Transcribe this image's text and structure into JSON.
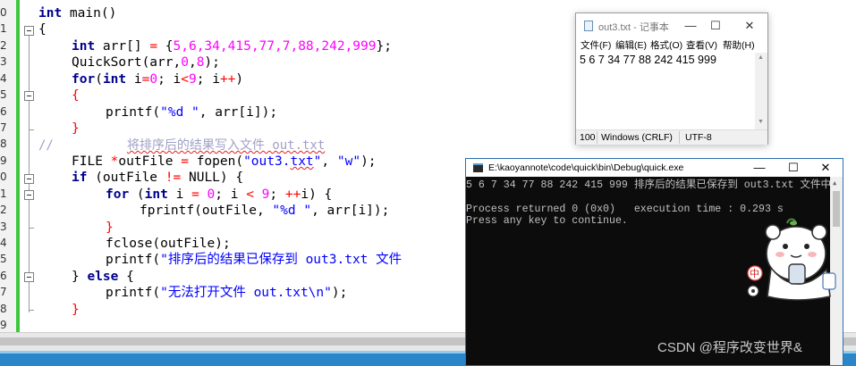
{
  "editor": {
    "line_numbers": [
      "0",
      "1",
      "2",
      "3",
      "4",
      "5",
      "6",
      "7",
      "8",
      "9",
      "0",
      "1",
      "2",
      "3",
      "4",
      "5",
      "6",
      "7",
      "8",
      "9"
    ],
    "code": {
      "l1": {
        "kw": "int",
        "rest": " main()"
      },
      "l2": {
        "brace": "{"
      },
      "l3": {
        "kw": "int",
        "a": " arr[] ",
        "op": "=",
        "b": " {",
        "nums": "5,6,34,415,77,7,88,242,999",
        "c": "};"
      },
      "l4": {
        "a": "QuickSort(arr,",
        "n1": "0",
        "b": ",",
        "n2": "8",
        "c": ");"
      },
      "l5": {
        "kw": "for",
        "a": "(",
        "kw2": "int",
        "b": " i",
        "op": "=",
        "n1": "0",
        "c": "; i",
        "op2": "<",
        "n2": "9",
        "d": "; i",
        "op3": "++",
        "e": ")"
      },
      "l6": {
        "brace": "{"
      },
      "l7": {
        "a": "printf(",
        "str": "\"%d \"",
        "b": ", arr[i]);"
      },
      "l8": {
        "brace": "}"
      },
      "l9": {
        "comment_marker": "//",
        "comment_text": "将排序后的结果写入文件 out.txt"
      },
      "l10": {
        "a": "FILE ",
        "op": "*",
        "b": "outFile ",
        "op2": "=",
        "c": " fopen(",
        "str1a": "\"out3.",
        "str1b": "txt",
        "str1c": "\"",
        "d": ", ",
        "str2": "\"w\"",
        "e": ");"
      },
      "l11": {
        "kw": "if",
        "a": " (outFile ",
        "op": "!=",
        "b": " NULL) {"
      },
      "l12": {
        "kw": "for",
        "a": " (",
        "kw2": "int",
        "b": " i ",
        "op": "=",
        "sp": " ",
        "n1": "0",
        "c": "; i ",
        "op2": "<",
        "sp2": " ",
        "n2": "9",
        "d": "; ",
        "op3": "++",
        "e": "i) {"
      },
      "l13": {
        "a": "fprintf(outFile, ",
        "str": "\"%d \"",
        "b": ", arr[i]);"
      },
      "l14": {
        "brace": "}"
      },
      "l15": {
        "a": "fclose(outFile);"
      },
      "l16": {
        "a": "printf(",
        "str": "\"排序后的结果已保存到 out3.txt 文件"
      },
      "l17": {
        "a": "} ",
        "kw": "else",
        "b": " {"
      },
      "l18": {
        "a": "printf(",
        "str": "\"无法打开文件 out.txt\\n\"",
        "b": ");"
      },
      "l19": {
        "brace": "}"
      }
    }
  },
  "notepad": {
    "title": "out3.txt - 记事本",
    "controls": {
      "minimize": "—",
      "maximize": "☐",
      "close": "✕"
    },
    "menu": [
      "文件(F)",
      "编辑(E)",
      "格式(O)",
      "查看(V)",
      "帮助(H)"
    ],
    "content": "5 6 7 34 77 88 242 415 999",
    "status": {
      "zoom": "100",
      "eol": "Windows (CRLF)",
      "encoding": "UTF-8"
    }
  },
  "console": {
    "title": "E:\\kaoyannote\\code\\quick\\bin\\Debug\\quick.exe",
    "controls": {
      "minimize": "—",
      "maximize": "☐",
      "close": "✕"
    },
    "lines": [
      "5 6 7 34 77 88 242 415 999 排序后的结果已保存到 out3.txt 文件中",
      "",
      "Process returned 0 (0x0)   execution time : 0.293 s",
      "Press any key to continue."
    ]
  },
  "sticker": {
    "badge_char": "中"
  },
  "watermark": "CSDN @程序改变世界&",
  "colors": {
    "keyword": "#00008b",
    "number": "#ff00ff",
    "string": "#0000ff",
    "operator": "#ff0000",
    "comment": "#a0a0c8",
    "gutter_green": "#3cc83c",
    "status_blue": "#2a86c8"
  }
}
